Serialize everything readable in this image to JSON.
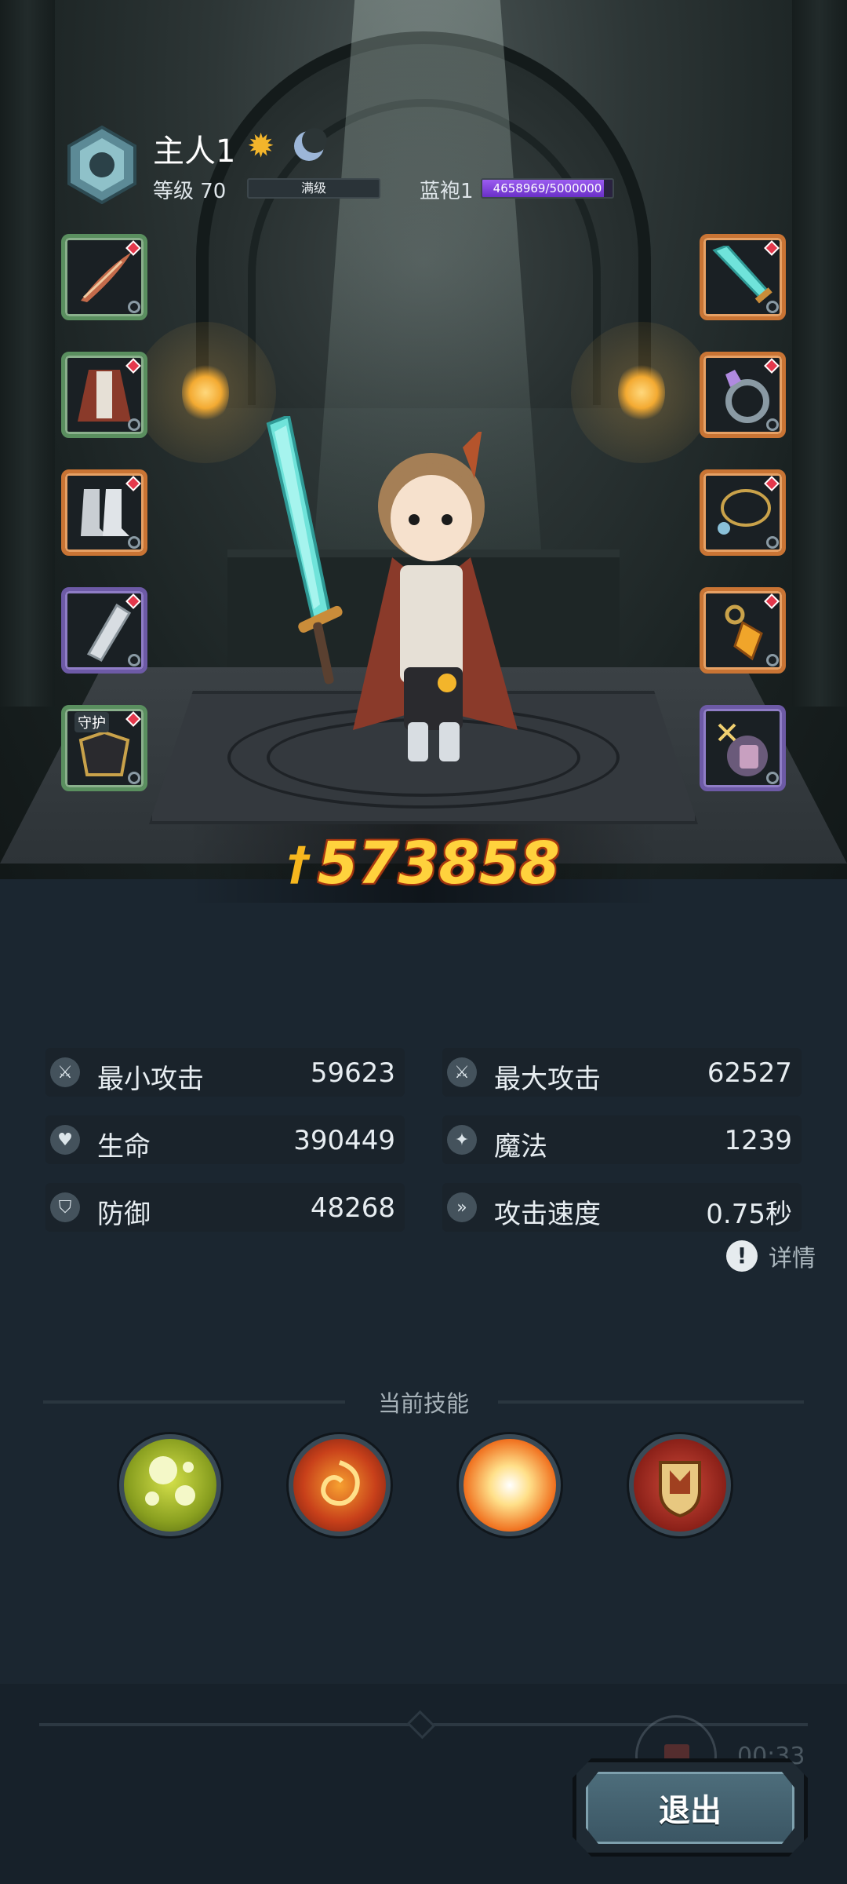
{
  "header": {
    "player_name": "主人1",
    "level_label": "等级 70",
    "level_bar_text": "满级",
    "pet_label": "蓝袍1",
    "pet_exp_text": "4658969/5000000",
    "pet_exp_current": 4658969,
    "pet_exp_max": 5000000,
    "icons": [
      "emblem-icon",
      "sun-icon",
      "moon-icon"
    ]
  },
  "equipment": {
    "left": [
      {
        "name": "feather-slot",
        "rarity": "green"
      },
      {
        "name": "robe-slot",
        "rarity": "green"
      },
      {
        "name": "boots-slot",
        "rarity": "orange"
      },
      {
        "name": "bracer-slot",
        "rarity": "purple"
      },
      {
        "name": "guard-slot",
        "rarity": "green",
        "tag": "守护"
      }
    ],
    "right": [
      {
        "name": "sword-slot",
        "rarity": "orange"
      },
      {
        "name": "ring-slot",
        "rarity": "orange"
      },
      {
        "name": "necklace-slot",
        "rarity": "orange"
      },
      {
        "name": "charm-slot",
        "rarity": "orange"
      },
      {
        "name": "pet-slot",
        "rarity": "purple"
      }
    ]
  },
  "power": {
    "value": "573858"
  },
  "stats": [
    {
      "label": "最小攻击",
      "value": "59623",
      "icon": "sword-icon"
    },
    {
      "label": "最大攻击",
      "value": "62527",
      "icon": "sword-icon"
    },
    {
      "label": "生命",
      "value": "390449",
      "icon": "heart-icon"
    },
    {
      "label": "魔法",
      "value": "1239",
      "icon": "magic-icon"
    },
    {
      "label": "防御",
      "value": "48268",
      "icon": "shield-icon"
    },
    {
      "label": "攻击速度",
      "value": "0.75秒",
      "icon": "speed-icon"
    }
  ],
  "details_label": "详情",
  "skills": {
    "title": "当前技能",
    "items": [
      "bubble-skill-icon",
      "fire-vortex-skill-icon",
      "burst-skill-icon",
      "shield-crest-skill-icon"
    ]
  },
  "footer": {
    "timer": "00:33",
    "exit_label": "退出"
  },
  "colors": {
    "gold": "#ffd23d",
    "exp_purple": "#9b5cf0",
    "background": "#1b2630"
  }
}
